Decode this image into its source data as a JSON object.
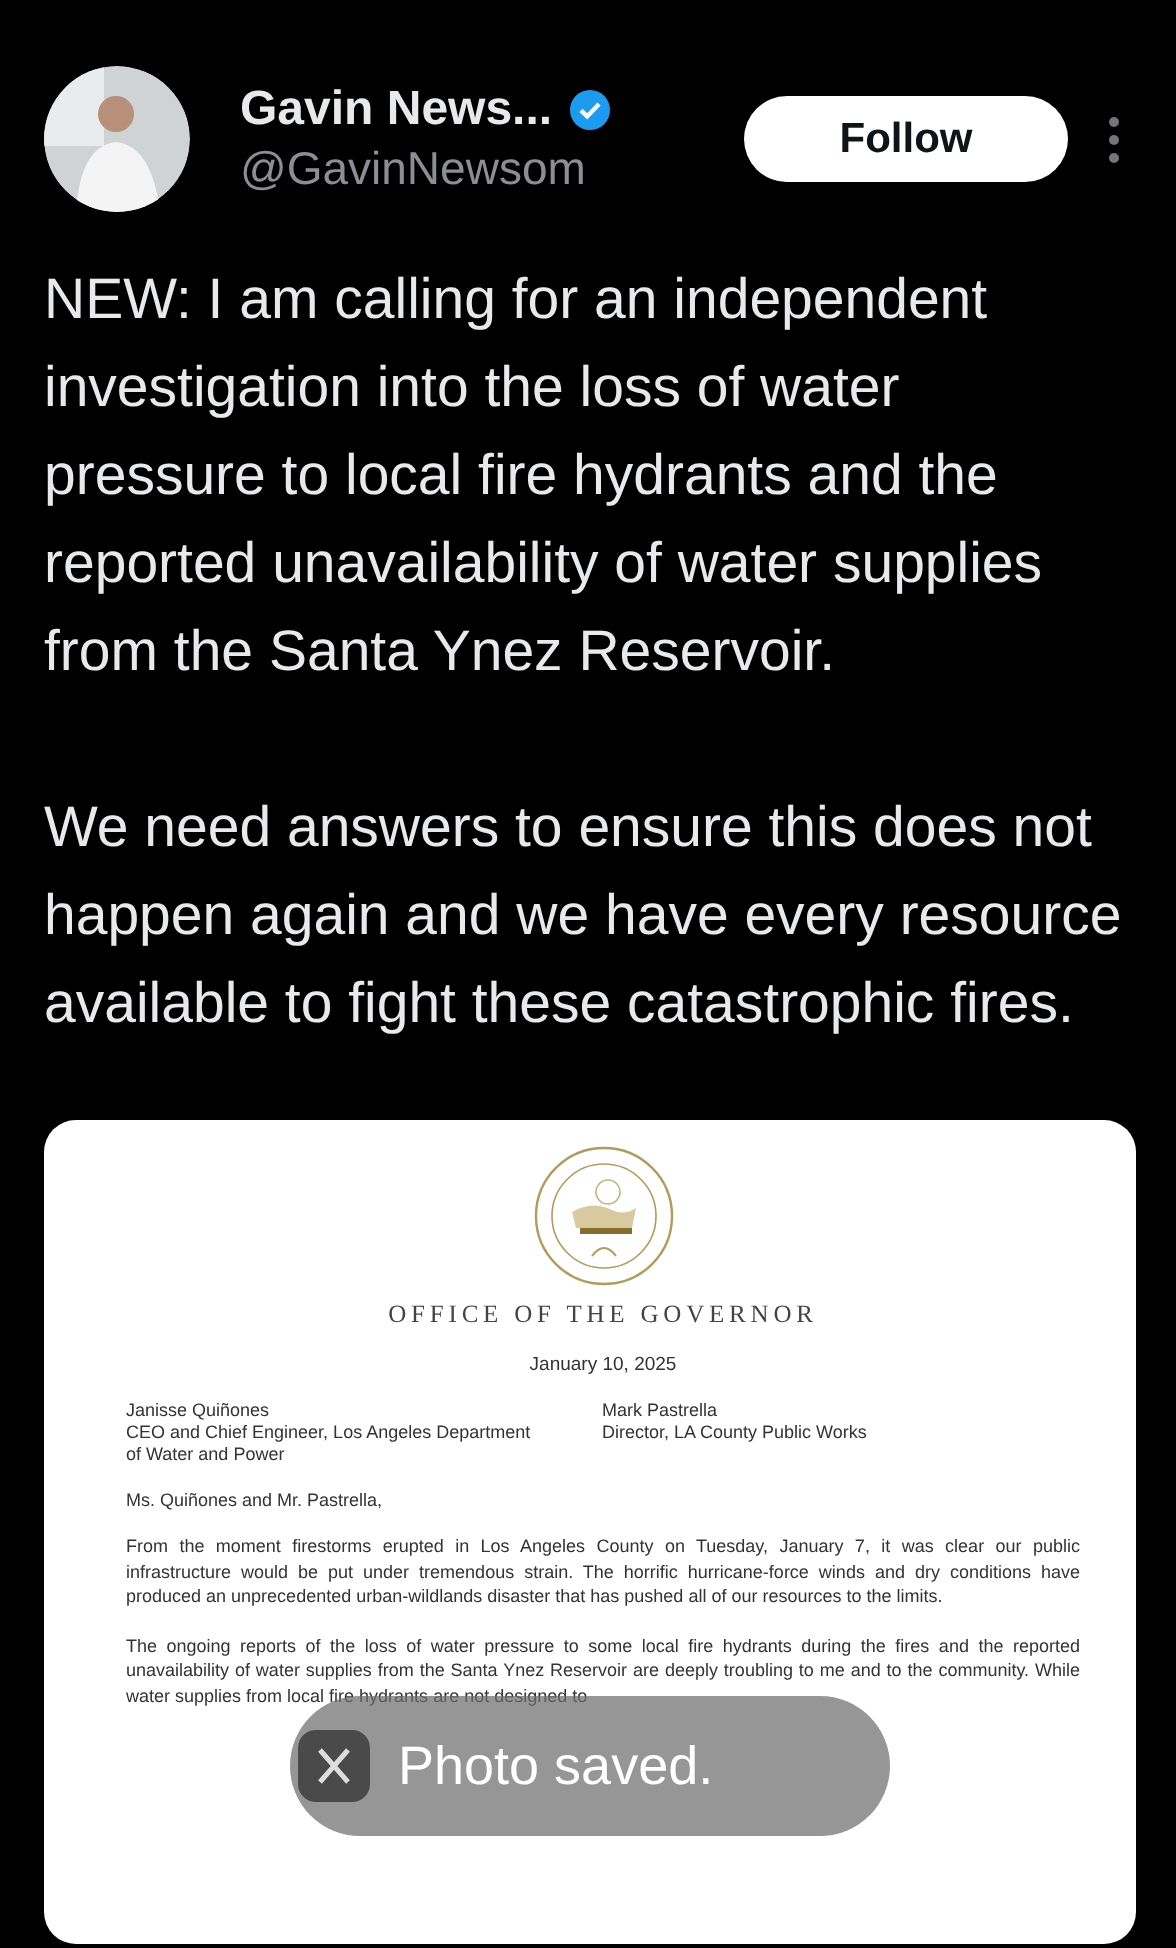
{
  "author": {
    "name": "Gavin News...",
    "handle": "@GavinNewsom",
    "verified": true
  },
  "follow_button": "Follow",
  "tweet_paragraphs": [
    "NEW: I am calling for an independent investigation into the loss of water pressure to local fire hydrants and the reported unavailability of water supplies from the Santa Ynez Reservoir.",
    "We need answers to ensure this does not happen again and we have every resource available to fight these catastrophic fires."
  ],
  "document": {
    "heading": "OFFICE OF THE GOVERNOR",
    "date": "January 10, 2025",
    "recipients": [
      {
        "name": "Janisse Quiñones",
        "title": "CEO and Chief Engineer, Los Angeles Department of Water and Power"
      },
      {
        "name": "Mark Pastrella",
        "title": "Director, LA County Public Works"
      }
    ],
    "salutation": "Ms. Quiñones and Mr. Pastrella,",
    "paragraphs": [
      "From the moment firestorms erupted in Los Angeles County on Tuesday, January 7, it was clear our public infrastructure would be put under tremendous strain. The horrific hurricane-force winds and dry conditions have produced an unprecedented urban-wildlands disaster that has pushed all of our resources to the limits.",
      "The ongoing reports of the loss of water pressure to some local fire hydrants during the fires and the reported unavailability of water supplies from the Santa Ynez Reservoir are deeply troubling to me and to the community. While water supplies from local fire hydrants are not designed to"
    ]
  },
  "toast": {
    "message": "Photo saved."
  }
}
